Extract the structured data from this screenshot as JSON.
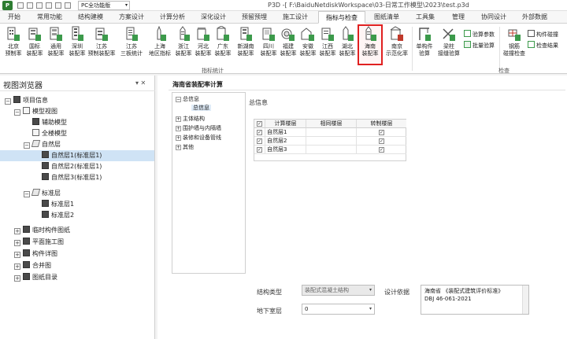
{
  "titlebar": {
    "logo": "P",
    "profile": "PC全功能版",
    "title": "P3D -[ F:\\BaiduNetdiskWorkspace\\03-日常工作模型\\2023\\test.p3d"
  },
  "tabs": [
    {
      "label": "开始",
      "active": false
    },
    {
      "label": "常用功能",
      "active": false
    },
    {
      "label": "结构建模",
      "active": false
    },
    {
      "label": "方案设计",
      "active": false
    },
    {
      "label": "计算分析",
      "active": false
    },
    {
      "label": "深化设计",
      "active": false
    },
    {
      "label": "预留预埋",
      "active": false
    },
    {
      "label": "施工设计",
      "active": false
    },
    {
      "label": "指标与检查",
      "active": true
    },
    {
      "label": "图纸清单",
      "active": false
    },
    {
      "label": "工具集",
      "active": false
    },
    {
      "label": "管理",
      "active": false
    },
    {
      "label": "协同设计",
      "active": false
    },
    {
      "label": "外部数据",
      "active": false
    }
  ],
  "ribbon": {
    "buttons": [
      {
        "l1": "北京",
        "l2": "预制率"
      },
      {
        "l1": "国标",
        "l2": "装配率"
      },
      {
        "l1": "通用",
        "l2": "装配率"
      },
      {
        "l1": "深圳",
        "l2": "装配率"
      },
      {
        "l1": "江苏",
        "l2": "预制装配率"
      },
      {
        "l1": "江苏",
        "l2": "三板统计"
      },
      {
        "l1": "上海",
        "l2": "地区指标"
      },
      {
        "l1": "浙江",
        "l2": "装配率"
      },
      {
        "l1": "河北",
        "l2": "装配率"
      },
      {
        "l1": "广东",
        "l2": "装配率"
      },
      {
        "l1": "新湖南",
        "l2": "装配率"
      },
      {
        "l1": "四川",
        "l2": "装配率"
      },
      {
        "l1": "福建",
        "l2": "装配率"
      },
      {
        "l1": "安徽",
        "l2": "装配率"
      },
      {
        "l1": "江西",
        "l2": "装配率"
      },
      {
        "l1": "湖北",
        "l2": "装配率"
      },
      {
        "l1": "海南",
        "l2": "装配率"
      },
      {
        "l1": "南京",
        "l2": "示范化率"
      },
      {
        "l1": "单构件",
        "l2": "验算"
      },
      {
        "l1": "梁柱",
        "l2": "接缝验算"
      },
      {
        "l1": "钢筋",
        "l2": "碰撞检查"
      }
    ],
    "small_buttons": [
      {
        "label": "验算参数"
      },
      {
        "label": "批量验算"
      },
      {
        "label": "构件碰撞"
      },
      {
        "label": "检查结果"
      }
    ],
    "group1_label": "指标统计",
    "group2_label": "检查"
  },
  "left_panel": {
    "title": "视图浏览器",
    "pin": "▾ ✕",
    "tree": [
      {
        "label": "项目信息",
        "expander": "−"
      },
      {
        "label": "模型视图",
        "expander": "−"
      },
      {
        "label": "辅助模型",
        "expander": ""
      },
      {
        "label": "全楼模型",
        "expander": ""
      },
      {
        "label": "自然层",
        "expander": "−"
      },
      {
        "label": "自然层1(标准层1)",
        "expander": ""
      },
      {
        "label": "自然层2(标准层1)",
        "expander": ""
      },
      {
        "label": "自然层3(标准层1)",
        "expander": ""
      },
      {
        "label": "标准层",
        "expander": "−"
      },
      {
        "label": "标准层1",
        "expander": ""
      },
      {
        "label": "标准层2",
        "expander": ""
      },
      {
        "label": "临时构件图纸",
        "expander": "+"
      },
      {
        "label": "平面施工图",
        "expander": "+"
      },
      {
        "label": "构件详图",
        "expander": "+"
      },
      {
        "label": "合并图",
        "expander": "+"
      },
      {
        "label": "图纸目录",
        "expander": "+"
      }
    ]
  },
  "main": {
    "title": "海南省装配率计算",
    "categories": [
      {
        "label": "总信息",
        "expander": "−"
      },
      {
        "label": "总信息",
        "expander": ""
      },
      {
        "label": "主体结构",
        "expander": "+"
      },
      {
        "label": "围护墙与内隔墙",
        "expander": "+"
      },
      {
        "label": "装修和设备管线",
        "expander": "+"
      },
      {
        "label": "其他",
        "expander": "+"
      }
    ],
    "section_title": "总信息",
    "grid": {
      "headers": [
        "计算楼层",
        "相同楼层",
        "转制楼层"
      ],
      "rows": [
        {
          "name": "自然层1",
          "same": "",
          "checked": true
        },
        {
          "name": "自然层2",
          "same": "",
          "checked": true
        },
        {
          "name": "自然层3",
          "same": "",
          "checked": true
        }
      ]
    },
    "fields": {
      "structure_type_label": "结构类型",
      "structure_type_value": "装配式混凝土结构",
      "basement_label": "地下室层",
      "basement_value": "0",
      "basis_label": "设计依据",
      "basis_line1": "海南省 《装配式建筑评价标准》",
      "basis_line2": "DBJ 46-061-2021"
    }
  }
}
